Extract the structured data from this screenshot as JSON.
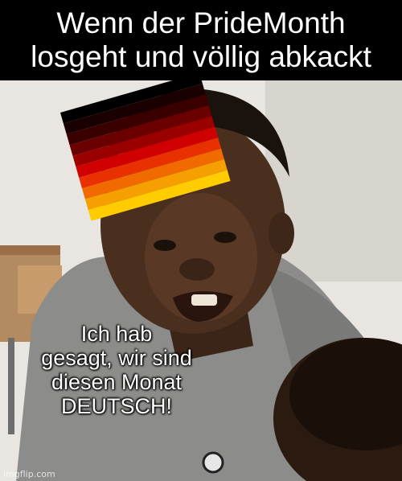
{
  "meme": {
    "top_caption_line1": "Wenn der PrideMonth",
    "top_caption_line2": "losgeht und völlig abkackt",
    "overlay_caption_line1": "Ich hab",
    "overlay_caption_line2": "gesagt, wir sind",
    "overlay_caption_line3": "diesen Monat",
    "overlay_caption_line4": "DEUTSCH!",
    "watermark": "imgflip.com"
  },
  "flag": {
    "stripe_colors": [
      "#000000",
      "#1a0000",
      "#3a0000",
      "#6a0000",
      "#9a0000",
      "#d10000",
      "#e83000",
      "#f06a00",
      "#f5a000",
      "#ffcc00"
    ]
  },
  "colors": {
    "caption_bg": "#000000",
    "caption_text": "#ffffff"
  }
}
